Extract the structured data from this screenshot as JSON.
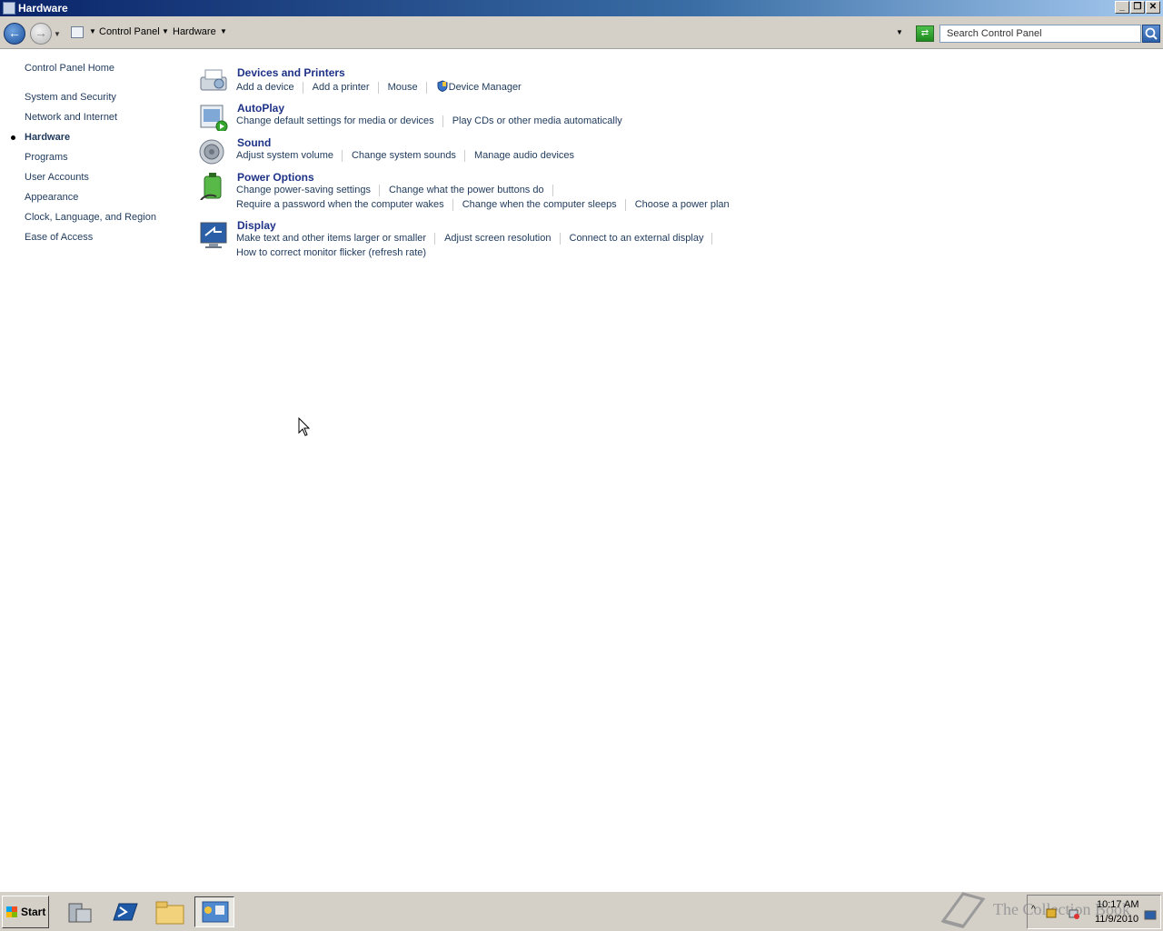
{
  "window": {
    "title": "Hardware",
    "minimize": "_",
    "restore": "❐",
    "close": "✕"
  },
  "address": {
    "crumbs": [
      "Control Panel",
      "Hardware"
    ],
    "search_placeholder": "Search Control Panel"
  },
  "leftnav": {
    "home": "Control Panel Home",
    "items": [
      {
        "label": "System and Security"
      },
      {
        "label": "Network and Internet"
      },
      {
        "label": "Hardware"
      },
      {
        "label": "Programs"
      },
      {
        "label": "User Accounts"
      },
      {
        "label": "Appearance"
      },
      {
        "label": "Clock, Language, and Region"
      },
      {
        "label": "Ease of Access"
      }
    ]
  },
  "categories": [
    {
      "title": "Devices and Printers",
      "links": [
        "Add a device",
        "Add a printer",
        "Mouse",
        "Device Manager"
      ]
    },
    {
      "title": "AutoPlay",
      "links": [
        "Change default settings for media or devices",
        "Play CDs or other media automatically"
      ]
    },
    {
      "title": "Sound",
      "links": [
        "Adjust system volume",
        "Change system sounds",
        "Manage audio devices"
      ]
    },
    {
      "title": "Power Options",
      "links": [
        "Change power-saving settings",
        "Change what the power buttons do"
      ],
      "links2": [
        "Require a password when the computer wakes",
        "Change when the computer sleeps",
        "Choose a power plan"
      ]
    },
    {
      "title": "Display",
      "links": [
        "Make text and other items larger or smaller",
        "Adjust screen resolution",
        "Connect to an external display"
      ],
      "links2": [
        "How to correct monitor flicker (refresh rate)"
      ]
    }
  ],
  "taskbar": {
    "start": "Start",
    "time": "10:17 AM",
    "date": "11/9/2010",
    "watermark": "The Collection Book"
  }
}
